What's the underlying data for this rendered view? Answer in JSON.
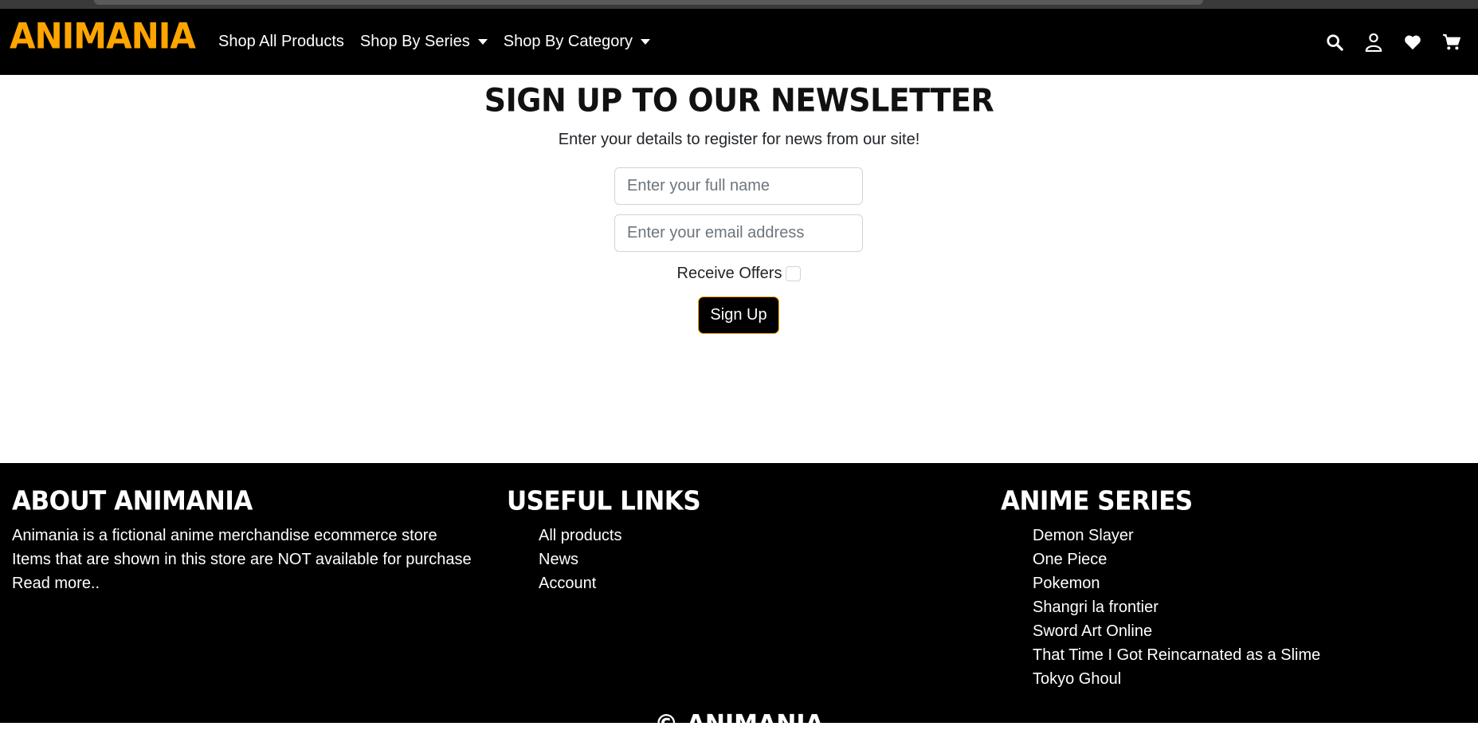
{
  "nav": {
    "brand": "Animania",
    "links": [
      "Shop All Products",
      "Shop By Series",
      "Shop By Category"
    ],
    "icons": [
      "search-icon",
      "user-icon",
      "heart-icon",
      "cart-icon"
    ]
  },
  "newsletter": {
    "title": "Sign up to our Newsletter",
    "subtitle": "Enter your details to register for news from our site!",
    "name_placeholder": "Enter your full name",
    "email_placeholder": "Enter your email address",
    "offers_label": "Receive Offers",
    "offers_checked": false,
    "button_label": "Sign Up"
  },
  "footer": {
    "about": {
      "heading": "About Animania",
      "lines": [
        "Animania is a fictional anime merchandise ecommerce store",
        "Items that are shown in this store are NOT available for purchase",
        "Read more.."
      ]
    },
    "links": {
      "heading": "Useful Links",
      "items": [
        "All products",
        "News",
        "Account"
      ]
    },
    "series": {
      "heading": "Anime Series",
      "items": [
        "Demon Slayer",
        "One Piece",
        "Pokemon",
        "Shangri la frontier",
        "Sword Art Online",
        "That Time I Got Reincarnated as a Slime",
        "Tokyo Ghoul"
      ]
    },
    "copyright": "© Animania"
  },
  "colors": {
    "brand": "#ffa500",
    "navbar_bg": "#000000",
    "footer_bg": "#000000"
  }
}
